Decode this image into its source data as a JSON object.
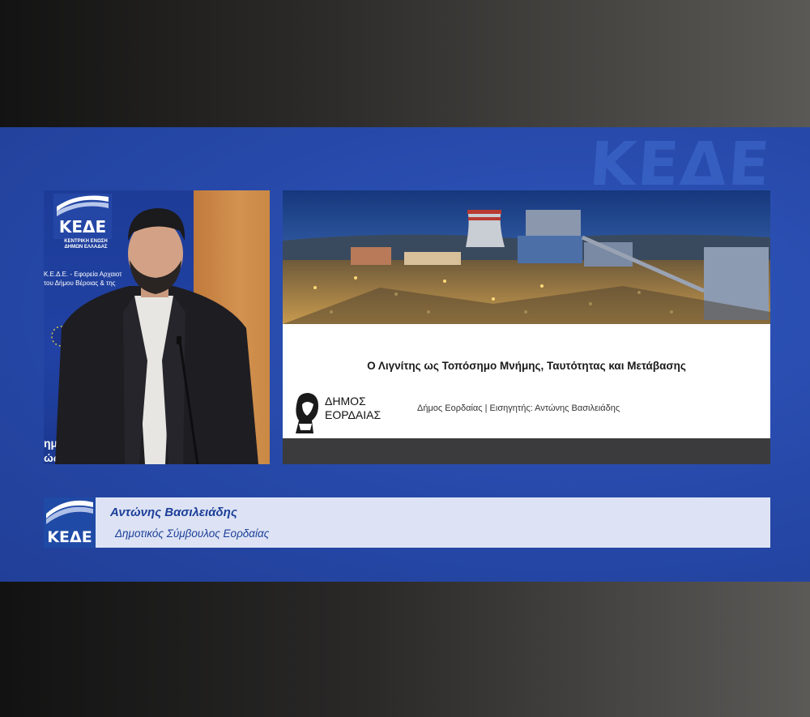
{
  "watermark": {
    "text": "ΚΕΔΕ"
  },
  "video": {
    "backdrop_logo_text": "ΚΕΔΕ",
    "backdrop_org_line1": "ΚΕΝΤΡΙΚΗ ΕΝΩΣΗ",
    "backdrop_org_line2": "ΔΗΜΩΝ ΕΛΛΑΔΑΣ",
    "backdrop_caption_line1": "Κ.Ε.Δ.Ε. - Εφορεία Αρχαιοτ",
    "backdrop_caption_line2": "του Δήμου Βέροιας & της",
    "backdrop_big_line1": "ημ",
    "backdrop_big_line2": "ώς Κ"
  },
  "slide": {
    "title": "Ο Λιγνίτης ως Τοπόσημο Μνήμης, Ταυτότητας και Μετάβασης",
    "logo_line1": "ΔΗΜΟΣ",
    "logo_line2": "ΕΟΡΔΑΙΑΣ",
    "subtitle": "Δήμος Εορδαίας | Εισηγητής: Αντώνης Βασιλειάδης"
  },
  "lower_third": {
    "logo_text": "ΚΕΔΕ",
    "speaker_name": "Αντώνης Βασιλειάδης",
    "speaker_role": "Δημοτικός Σύμβουλος Εορδαίας"
  },
  "colors": {
    "broadcast_blue": "#2648a8",
    "lower_third_bg": "#dde3f4",
    "lower_third_text": "#1b3e98",
    "backdrop_orange": "#c98844"
  }
}
